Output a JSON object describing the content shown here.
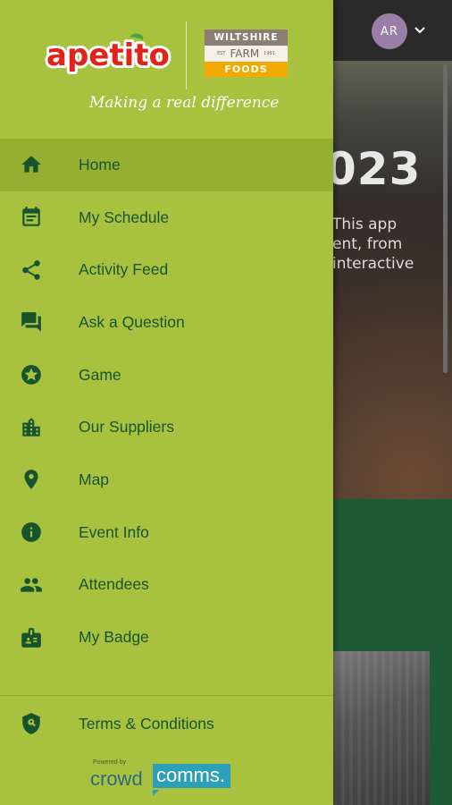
{
  "background": {
    "avatar_initials": "AR",
    "hero_year_fragment": "023",
    "hero_text_lines": [
      "This app",
      "ent, from",
      "interactive"
    ]
  },
  "drawer": {
    "logo": {
      "apetito": "apetito",
      "wff_top": "WILTSHIRE",
      "wff_est": "EST",
      "wff_mid": "FARM",
      "wff_year": "1991",
      "wff_bottom": "FOODS",
      "tagline": "Making a real difference"
    },
    "menu": [
      {
        "label": "Home",
        "icon": "home-icon",
        "active": true
      },
      {
        "label": "My Schedule",
        "icon": "calendar-icon",
        "active": false
      },
      {
        "label": "Activity Feed",
        "icon": "share-icon",
        "active": false
      },
      {
        "label": "Ask a Question",
        "icon": "chat-icon",
        "active": false
      },
      {
        "label": "Game",
        "icon": "star-badge-icon",
        "active": false
      },
      {
        "label": "Our Suppliers",
        "icon": "building-icon",
        "active": false
      },
      {
        "label": "Map",
        "icon": "map-pin-icon",
        "active": false
      },
      {
        "label": "Event Info",
        "icon": "info-icon",
        "active": false
      },
      {
        "label": "Attendees",
        "icon": "people-icon",
        "active": false
      },
      {
        "label": "My Badge",
        "icon": "badge-icon",
        "active": false
      }
    ],
    "terms": {
      "label": "Terms & Conditions",
      "icon": "shield-search-icon"
    },
    "powered_by": {
      "small": "Powered by",
      "word_left": "crowd",
      "word_right": "comms",
      "dot": "."
    }
  },
  "colors": {
    "drawer_bg": "#a8c23f",
    "active_bg": "#95b030",
    "icon_text": "#17542e",
    "accent_green": "#1e5a36"
  }
}
